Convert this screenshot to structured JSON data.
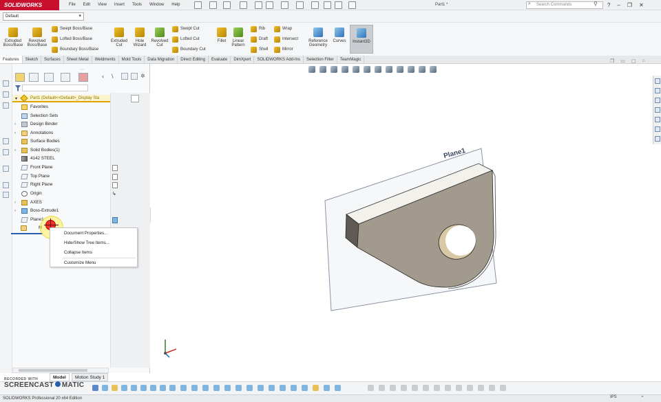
{
  "app": {
    "logo": "SOLIDWORKS",
    "doc_title": "Part1 *"
  },
  "menu": [
    "File",
    "Edit",
    "View",
    "Insert",
    "Tools",
    "Window",
    "Help"
  ],
  "search": {
    "placeholder": "Search Commands"
  },
  "config_dropdown": {
    "value": "Default"
  },
  "ribbon": {
    "big": [
      {
        "label1": "Extruded",
        "label2": "Boss/Base"
      },
      {
        "label1": "Revolved",
        "label2": "Boss/Base"
      },
      {
        "label1": "Extruded",
        "label2": "Cut"
      },
      {
        "label1": "Hole",
        "label2": "Wizard"
      },
      {
        "label1": "Revolved",
        "label2": "Cut"
      },
      {
        "label1": "Fillet",
        "label2": ""
      },
      {
        "label1": "Linear",
        "label2": "Pattern"
      },
      {
        "label1": "Reference",
        "label2": "Geometry"
      },
      {
        "label1": "Curves",
        "label2": ""
      },
      {
        "label1": "Instant3D",
        "label2": ""
      }
    ],
    "small": {
      "boss": [
        "Swept Boss/Base",
        "Lofted Boss/Base",
        "Boundary Boss/Base"
      ],
      "cut": [
        "Swept Cut",
        "Lofted Cut",
        "Boundary Cut"
      ],
      "feat1": [
        "Rib",
        "Draft",
        "Shell"
      ],
      "feat2": [
        "Wrap",
        "Intersect",
        "Mirror"
      ]
    }
  },
  "tabs": [
    "Features",
    "Sketch",
    "Surfaces",
    "Sheet Metal",
    "Weldments",
    "Mold Tools",
    "Data Migration",
    "Direct Editing",
    "Evaluate",
    "DimXpert",
    "SOLIDWORKS Add-Ins",
    "Selection Filter",
    "TeamMagic"
  ],
  "tree": {
    "part": "Part1  (Default<<Default>_Display Sta",
    "items": [
      "Favorites",
      "Selection Sets",
      "Design Binder",
      "Annotations",
      "Surface Bodies",
      "Solid Bodies(1)",
      "4142 STEEL",
      "Front Plane",
      "Top Plane",
      "Right Plane",
      "Origin",
      "AXES",
      "Boss-Extrude1",
      "Plane1",
      "M"
    ]
  },
  "context_menu": [
    "Document Properties...",
    "Hide/Show Tree Items...",
    "Collapse Items",
    "Customize Menu"
  ],
  "viewport": {
    "plane_label": "Plane1"
  },
  "bottom_tabs": [
    "Model",
    "Motion Study 1"
  ],
  "watermark": {
    "line1": "RECORDED WITH",
    "line2": "SCREENCAST",
    "line3": "MATIC"
  },
  "status": {
    "left": "SOLIDWORKS Professional 20   x64 Edition",
    "units": "IPS"
  },
  "colors": {
    "brand": "#c8102e",
    "highlight": "#fbf5cf"
  }
}
